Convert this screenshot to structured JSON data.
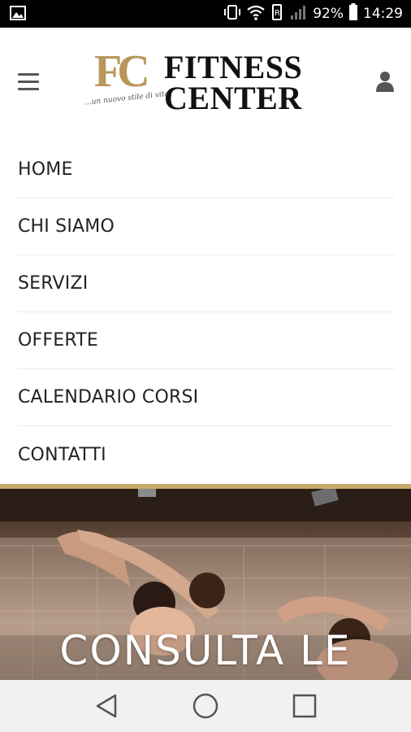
{
  "status_bar": {
    "battery_percent": "92%",
    "time": "14:29",
    "icons": [
      "image-icon",
      "vibrate-icon",
      "wifi-icon",
      "data-saver-icon",
      "signal-icon",
      "battery-icon"
    ]
  },
  "header": {
    "logo": {
      "monogram": "FC",
      "tagline": "...un nuovo stile di vita!",
      "line1": "FITNESS",
      "line2": "CENTER"
    },
    "menu_icon": "hamburger-menu-icon",
    "account_icon": "user-icon"
  },
  "menu": {
    "items": [
      {
        "label": "HOME"
      },
      {
        "label": "CHI SIAMO"
      },
      {
        "label": "SERVIZI"
      },
      {
        "label": "OFFERTE"
      },
      {
        "label": "CALENDARIO CORSI"
      },
      {
        "label": "CONTATTI"
      }
    ]
  },
  "hero": {
    "headline": "CONSULTA LE"
  },
  "nav_bar": {
    "buttons": [
      "back-icon",
      "home-icon",
      "recents-icon"
    ]
  },
  "colors": {
    "accent_gold": "#c9a96b",
    "logo_gold": "#b8975a",
    "status_bar": "#000000",
    "nav_bar": "#f1f1f1"
  }
}
